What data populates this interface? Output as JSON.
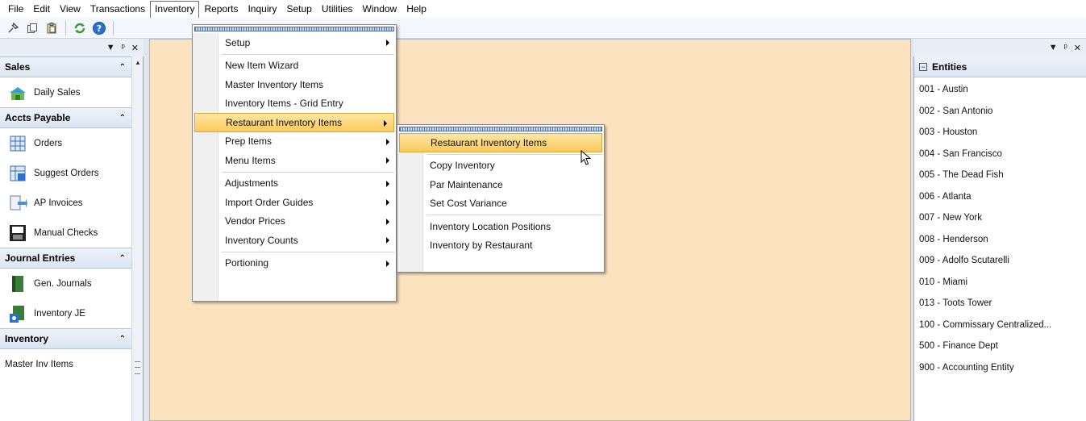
{
  "menubar": {
    "items": [
      "File",
      "Edit",
      "View",
      "Transactions",
      "Inventory",
      "Reports",
      "Inquiry",
      "Setup",
      "Utilities",
      "Window",
      "Help"
    ],
    "active": "Inventory"
  },
  "toolbar": {
    "icons": [
      "pin-icon",
      "copy-icon",
      "paste-icon",
      "refresh-icon",
      "help-icon"
    ]
  },
  "left_panel": {
    "controls": [
      "▾",
      "ᵖ",
      "✕"
    ],
    "sections": [
      {
        "header": "Sales",
        "items": [
          {
            "label": "Daily Sales",
            "icon": "store-icon"
          }
        ]
      },
      {
        "header": "Accts Payable",
        "items": [
          {
            "label": "Orders",
            "icon": "grid-icon"
          },
          {
            "label": "Suggest Orders",
            "icon": "suggest-icon"
          },
          {
            "label": "AP Invoices",
            "icon": "invoice-icon"
          },
          {
            "label": "Manual Checks",
            "icon": "check-icon"
          }
        ]
      },
      {
        "header": "Journal Entries",
        "items": [
          {
            "label": "Gen. Journals",
            "icon": "book-icon"
          },
          {
            "label": "Inventory JE",
            "icon": "inventory-je-icon"
          }
        ]
      },
      {
        "header": "Inventory",
        "items": [
          {
            "label": "Master Inv Items",
            "icon": ""
          }
        ]
      }
    ]
  },
  "right_panel": {
    "controls": [
      "▾",
      "ᵖ",
      "✕"
    ],
    "header": "Entities",
    "collapse_glyph": "−",
    "items": [
      "001 - Austin",
      "002 - San Antonio",
      "003 - Houston",
      "004 - San Francisco",
      "005 - The Dead Fish",
      "006 - Atlanta",
      "007 - New York",
      "008 - Henderson",
      "009 - Adolfo Scutarelli",
      "010 - Miami",
      "013 - Toots Tower",
      "100 - Commissary Centralized...",
      "500 - Finance Dept",
      "900 - Accounting Entity"
    ]
  },
  "inventory_menu": {
    "items": [
      {
        "label": "Setup",
        "submenu": true,
        "sep_after": true
      },
      {
        "label": "New Item Wizard",
        "submenu": false
      },
      {
        "label": "Master Inventory Items",
        "submenu": false
      },
      {
        "label": "Inventory Items - Grid Entry",
        "submenu": false
      },
      {
        "label": "Restaurant Inventory Items",
        "submenu": true,
        "highlight": true
      },
      {
        "label": "Prep Items",
        "submenu": true
      },
      {
        "label": "Menu Items",
        "submenu": true,
        "sep_after": true
      },
      {
        "label": "Adjustments",
        "submenu": true
      },
      {
        "label": "Import Order Guides",
        "submenu": true
      },
      {
        "label": "Vendor Prices",
        "submenu": true
      },
      {
        "label": "Inventory Counts",
        "submenu": true,
        "sep_after": true
      },
      {
        "label": "Portioning",
        "submenu": true
      }
    ]
  },
  "restaurant_submenu": {
    "items": [
      {
        "label": "Restaurant Inventory Items",
        "highlight": true,
        "sep_after": true
      },
      {
        "label": "Copy Inventory"
      },
      {
        "label": "Par Maintenance"
      },
      {
        "label": "Set Cost Variance",
        "sep_after": true
      },
      {
        "label": "Inventory Location Positions"
      },
      {
        "label": "Inventory by Restaurant"
      }
    ]
  }
}
